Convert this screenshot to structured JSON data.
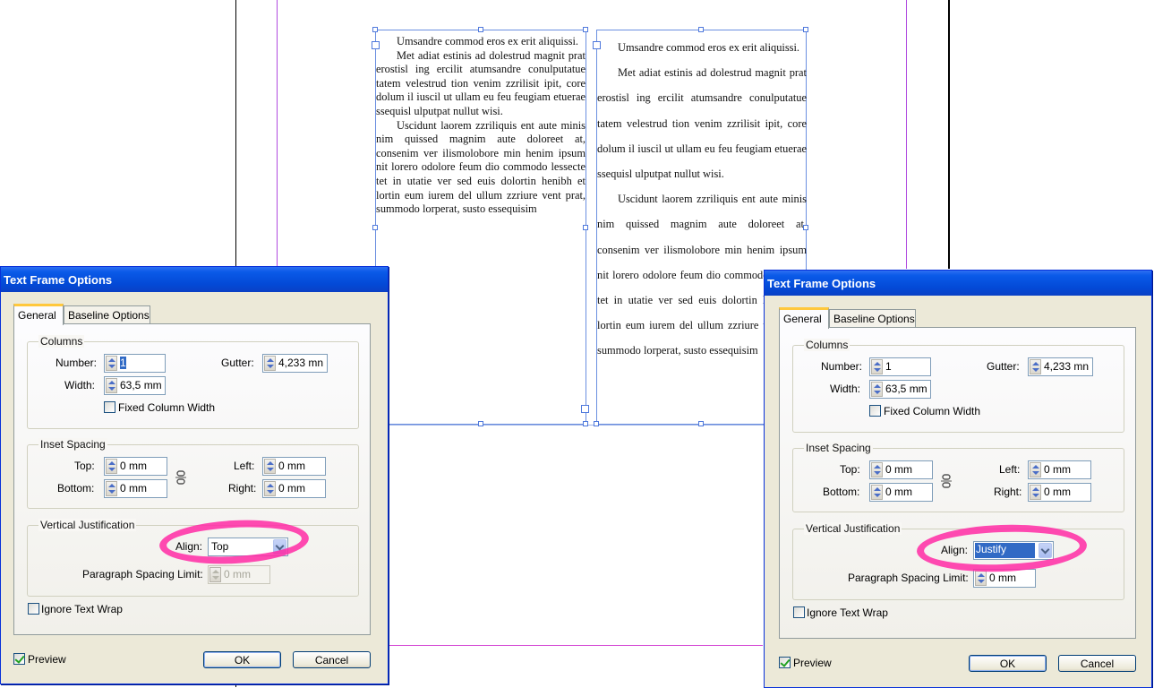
{
  "frame_text": {
    "p1": "Umsandre commod eros ex erit aliquissi.",
    "p2": "Met adiat estinis ad dolestrud magnit prat erostisl ing ercilit atumsandre conulputatue tatem velestrud tion venim zzrilisit ipit, core dolum il iuscil ut ullam eu feu feugiam etuerae ssequisl ulputpat nullut wisi.",
    "p3": "Uscidunt laorem zzriliquis ent aute minis nim quissed magnim aute doloreet at, consenim ver ilismolobore min henim ipsum nit lorero odolore feum dio commodo lessecte tet in utatie ver sed euis dolortin henibh et lortin eum iurem del ullum zzriure vent prat, summodo lorperat, susto essequisim"
  },
  "dialogs": [
    {
      "title": "Text Frame Options",
      "tabs": [
        "General",
        "Baseline Options"
      ],
      "columns_label": "Columns",
      "number_label": "Number:",
      "number_value": "1",
      "gutter_label": "Gutter:",
      "gutter_value": "4,233 mn",
      "width_label": "Width:",
      "width_value": "63,5 mm",
      "fixed_column_width_label": "Fixed Column Width",
      "fixed_column_width_checked": false,
      "inset_label": "Inset Spacing",
      "top_label": "Top:",
      "top_value": "0 mm",
      "bottom_label": "Bottom:",
      "bottom_value": "0 mm",
      "left_label": "Left:",
      "left_value": "0 mm",
      "right_label": "Right:",
      "right_value": "0 mm",
      "vj_label": "Vertical Justification",
      "align_label": "Align:",
      "align_value": "Top",
      "psl_label": "Paragraph Spacing Limit:",
      "psl_value": "0 mm",
      "psl_enabled": false,
      "ignore_wrap_label": "Ignore Text Wrap",
      "ignore_wrap_checked": false,
      "preview_label": "Preview",
      "preview_checked": true,
      "ok_label": "OK",
      "cancel_label": "Cancel"
    },
    {
      "title": "Text Frame Options",
      "tabs": [
        "General",
        "Baseline Options"
      ],
      "columns_label": "Columns",
      "number_label": "Number:",
      "number_value": "1",
      "gutter_label": "Gutter:",
      "gutter_value": "4,233 mn",
      "width_label": "Width:",
      "width_value": "63,5 mm",
      "fixed_column_width_label": "Fixed Column Width",
      "fixed_column_width_checked": false,
      "inset_label": "Inset Spacing",
      "top_label": "Top:",
      "top_value": "0 mm",
      "bottom_label": "Bottom:",
      "bottom_value": "0 mm",
      "left_label": "Left:",
      "left_value": "0 mm",
      "right_label": "Right:",
      "right_value": "0 mm",
      "vj_label": "Vertical Justification",
      "align_label": "Align:",
      "align_value": "Justify",
      "psl_label": "Paragraph Spacing Limit:",
      "psl_value": "0 mm",
      "psl_enabled": true,
      "ignore_wrap_label": "Ignore Text Wrap",
      "ignore_wrap_checked": false,
      "preview_label": "Preview",
      "preview_checked": true,
      "ok_label": "OK",
      "cancel_label": "Cancel"
    }
  ],
  "colors": {
    "highlight_ring": "#ff2aa5",
    "frame_border": "#6b8fe0",
    "margin_guide": "#b04be0",
    "title_bar": "#0a5ae8"
  }
}
